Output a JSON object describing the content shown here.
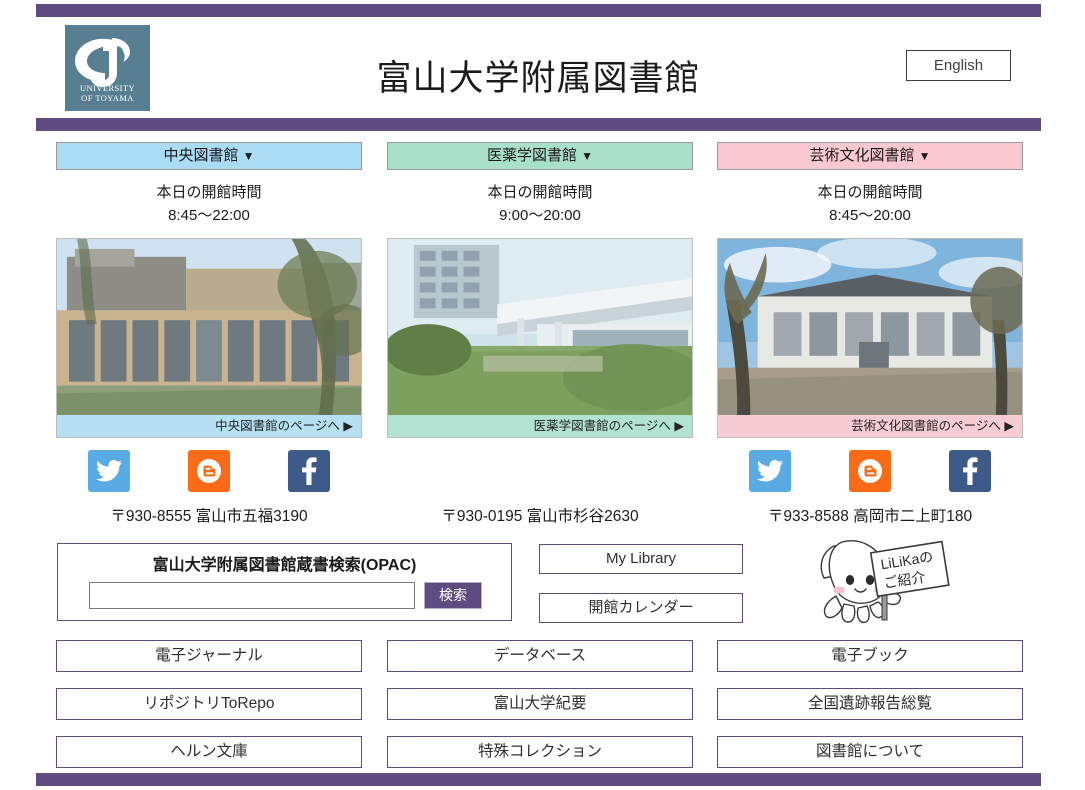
{
  "header": {
    "title": "富山大学附属図書館",
    "logo_line1": "UNIVERSITY",
    "logo_line2": "OF TOYAMA",
    "english_button": "English"
  },
  "colors": {
    "purple_bar": "#5e4b7f",
    "central_accent": "#aadcf5",
    "medical_accent": "#a9e0cb",
    "arts_accent": "#fac8cf",
    "twitter": "#5aabe3",
    "blogger": "#f96b16",
    "facebook": "#3e5a89"
  },
  "libraries": [
    {
      "name": "中央図書館",
      "caret": "▼",
      "hours_label": "本日の開館時間",
      "hours_value": "8:45〜22:00",
      "photo_caption": "中央図書館のページへ  ▶",
      "address": "〒930-8555 富山市五福3190",
      "socials": [
        "twitter-icon",
        "blogger-icon",
        "facebook-icon"
      ]
    },
    {
      "name": "医薬学図書館",
      "caret": "▼",
      "hours_label": "本日の開館時間",
      "hours_value": "9:00〜20:00",
      "photo_caption": "医薬学図書館のページへ  ▶",
      "address": "〒930-0195 富山市杉谷2630",
      "socials": []
    },
    {
      "name": "芸術文化図書館",
      "caret": "▼",
      "hours_label": "本日の開館時間",
      "hours_value": "8:45〜20:00",
      "photo_caption": "芸術文化図書館のページへ  ▶",
      "address": "〒933-8588 高岡市二上町180",
      "socials": [
        "twitter-icon",
        "blogger-icon",
        "facebook-icon"
      ]
    }
  ],
  "opac": {
    "title": "富山大学附属図書館蔵書検索(OPAC)",
    "input_value": "",
    "input_placeholder": "",
    "search_button": "検索"
  },
  "side_buttons": {
    "my_library": "My Library",
    "calendar": "開館カレンダー"
  },
  "mascot": {
    "sign_line1": "LiLiKaの",
    "sign_line2": "ご紹介"
  },
  "grid": [
    {
      "label": "電子ジャーナル"
    },
    {
      "label": "データベース"
    },
    {
      "label": "電子ブック"
    },
    {
      "label": "リポジトリToRepo"
    },
    {
      "label": "富山大学紀要"
    },
    {
      "label": "全国遺跡報告総覧"
    },
    {
      "label": "ヘルン文庫"
    },
    {
      "label": "特殊コレクション"
    },
    {
      "label": "図書館について"
    }
  ]
}
